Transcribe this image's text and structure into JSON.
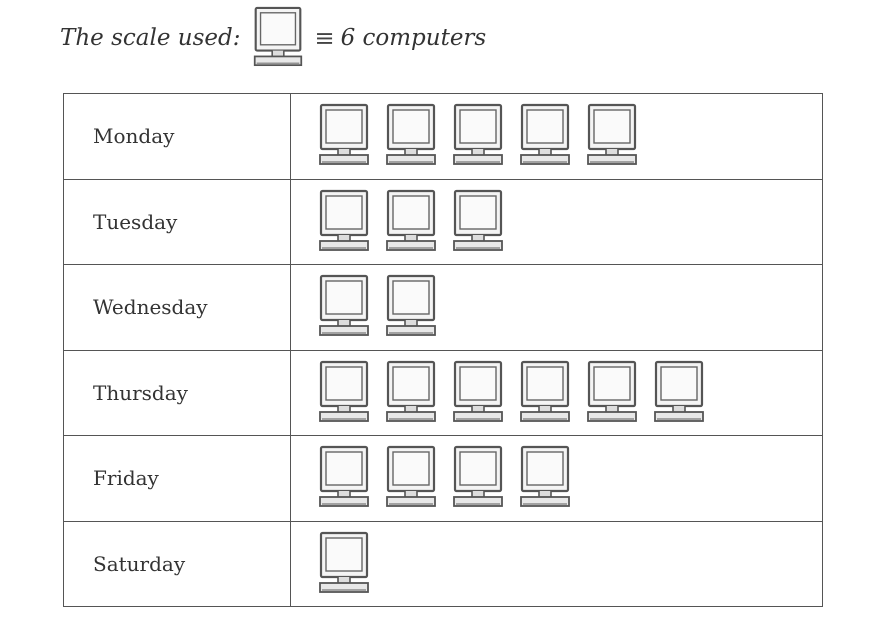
{
  "chart_data": {
    "type": "pictograph",
    "title": "",
    "scale": {
      "label": "The scale used:",
      "equals_text": "6 computers",
      "value_per_icon": 6,
      "icon": "computer-icon"
    },
    "categories": [
      "Monday",
      "Tuesday",
      "Wednesday",
      "Thursday",
      "Friday",
      "Saturday"
    ],
    "icon_counts": [
      5,
      3,
      2,
      6,
      4,
      1
    ],
    "values": [
      30,
      18,
      12,
      36,
      24,
      6
    ]
  },
  "equiv_symbol": "≡"
}
